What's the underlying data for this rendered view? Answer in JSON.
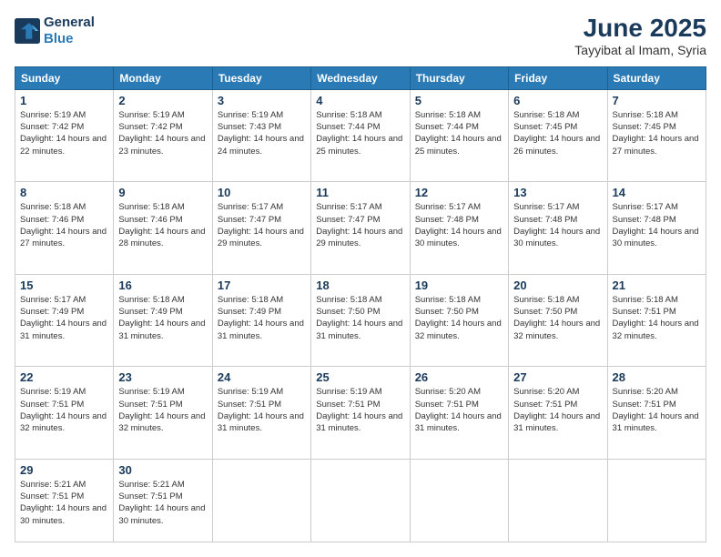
{
  "header": {
    "logo_line1": "General",
    "logo_line2": "Blue",
    "month": "June 2025",
    "location": "Tayyibat al Imam, Syria"
  },
  "weekdays": [
    "Sunday",
    "Monday",
    "Tuesday",
    "Wednesday",
    "Thursday",
    "Friday",
    "Saturday"
  ],
  "weeks": [
    [
      {
        "day": "1",
        "sunrise": "5:19 AM",
        "sunset": "7:42 PM",
        "daylight": "14 hours and 22 minutes."
      },
      {
        "day": "2",
        "sunrise": "5:19 AM",
        "sunset": "7:42 PM",
        "daylight": "14 hours and 23 minutes."
      },
      {
        "day": "3",
        "sunrise": "5:19 AM",
        "sunset": "7:43 PM",
        "daylight": "14 hours and 24 minutes."
      },
      {
        "day": "4",
        "sunrise": "5:18 AM",
        "sunset": "7:44 PM",
        "daylight": "14 hours and 25 minutes."
      },
      {
        "day": "5",
        "sunrise": "5:18 AM",
        "sunset": "7:44 PM",
        "daylight": "14 hours and 25 minutes."
      },
      {
        "day": "6",
        "sunrise": "5:18 AM",
        "sunset": "7:45 PM",
        "daylight": "14 hours and 26 minutes."
      },
      {
        "day": "7",
        "sunrise": "5:18 AM",
        "sunset": "7:45 PM",
        "daylight": "14 hours and 27 minutes."
      }
    ],
    [
      {
        "day": "8",
        "sunrise": "5:18 AM",
        "sunset": "7:46 PM",
        "daylight": "14 hours and 27 minutes."
      },
      {
        "day": "9",
        "sunrise": "5:18 AM",
        "sunset": "7:46 PM",
        "daylight": "14 hours and 28 minutes."
      },
      {
        "day": "10",
        "sunrise": "5:17 AM",
        "sunset": "7:47 PM",
        "daylight": "14 hours and 29 minutes."
      },
      {
        "day": "11",
        "sunrise": "5:17 AM",
        "sunset": "7:47 PM",
        "daylight": "14 hours and 29 minutes."
      },
      {
        "day": "12",
        "sunrise": "5:17 AM",
        "sunset": "7:48 PM",
        "daylight": "14 hours and 30 minutes."
      },
      {
        "day": "13",
        "sunrise": "5:17 AM",
        "sunset": "7:48 PM",
        "daylight": "14 hours and 30 minutes."
      },
      {
        "day": "14",
        "sunrise": "5:17 AM",
        "sunset": "7:48 PM",
        "daylight": "14 hours and 30 minutes."
      }
    ],
    [
      {
        "day": "15",
        "sunrise": "5:17 AM",
        "sunset": "7:49 PM",
        "daylight": "14 hours and 31 minutes."
      },
      {
        "day": "16",
        "sunrise": "5:18 AM",
        "sunset": "7:49 PM",
        "daylight": "14 hours and 31 minutes."
      },
      {
        "day": "17",
        "sunrise": "5:18 AM",
        "sunset": "7:49 PM",
        "daylight": "14 hours and 31 minutes."
      },
      {
        "day": "18",
        "sunrise": "5:18 AM",
        "sunset": "7:50 PM",
        "daylight": "14 hours and 31 minutes."
      },
      {
        "day": "19",
        "sunrise": "5:18 AM",
        "sunset": "7:50 PM",
        "daylight": "14 hours and 32 minutes."
      },
      {
        "day": "20",
        "sunrise": "5:18 AM",
        "sunset": "7:50 PM",
        "daylight": "14 hours and 32 minutes."
      },
      {
        "day": "21",
        "sunrise": "5:18 AM",
        "sunset": "7:51 PM",
        "daylight": "14 hours and 32 minutes."
      }
    ],
    [
      {
        "day": "22",
        "sunrise": "5:19 AM",
        "sunset": "7:51 PM",
        "daylight": "14 hours and 32 minutes."
      },
      {
        "day": "23",
        "sunrise": "5:19 AM",
        "sunset": "7:51 PM",
        "daylight": "14 hours and 32 minutes."
      },
      {
        "day": "24",
        "sunrise": "5:19 AM",
        "sunset": "7:51 PM",
        "daylight": "14 hours and 31 minutes."
      },
      {
        "day": "25",
        "sunrise": "5:19 AM",
        "sunset": "7:51 PM",
        "daylight": "14 hours and 31 minutes."
      },
      {
        "day": "26",
        "sunrise": "5:20 AM",
        "sunset": "7:51 PM",
        "daylight": "14 hours and 31 minutes."
      },
      {
        "day": "27",
        "sunrise": "5:20 AM",
        "sunset": "7:51 PM",
        "daylight": "14 hours and 31 minutes."
      },
      {
        "day": "28",
        "sunrise": "5:20 AM",
        "sunset": "7:51 PM",
        "daylight": "14 hours and 31 minutes."
      }
    ],
    [
      {
        "day": "29",
        "sunrise": "5:21 AM",
        "sunset": "7:51 PM",
        "daylight": "14 hours and 30 minutes."
      },
      {
        "day": "30",
        "sunrise": "5:21 AM",
        "sunset": "7:51 PM",
        "daylight": "14 hours and 30 minutes."
      },
      null,
      null,
      null,
      null,
      null
    ]
  ]
}
